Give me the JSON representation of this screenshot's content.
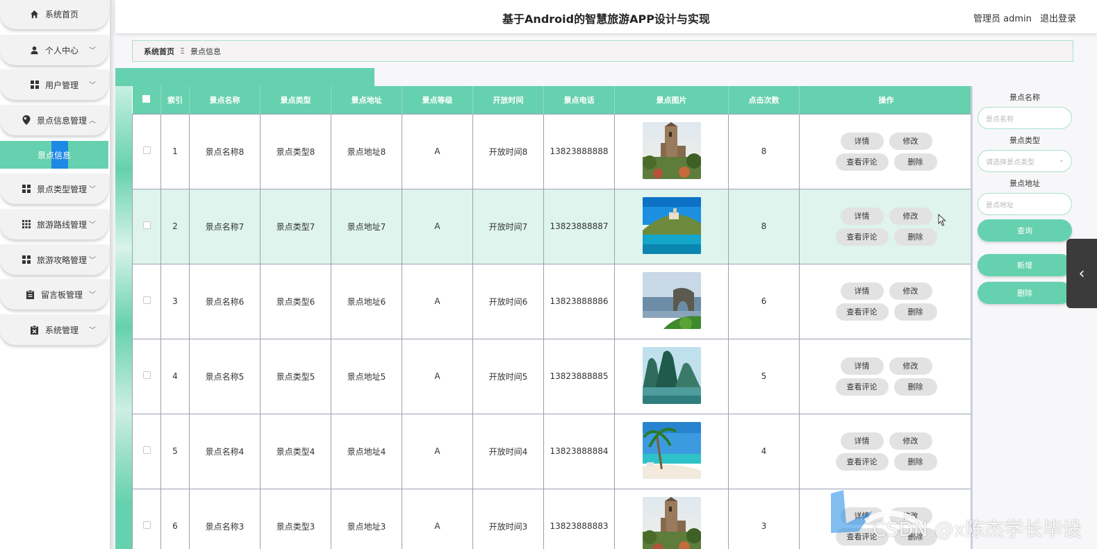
{
  "header": {
    "title": "基于Android的智慧旅游APP设计与实现",
    "user_label": "管理员 admin",
    "logout_label": "退出登录"
  },
  "sidebar": {
    "items": [
      {
        "label": "系统首页",
        "icon": "home-icon",
        "expandable": false
      },
      {
        "label": "个人中心",
        "icon": "user-icon",
        "expandable": true
      },
      {
        "label": "用户管理",
        "icon": "grid-icon",
        "expandable": true
      },
      {
        "label": "景点信息管理",
        "icon": "location-pin-icon",
        "expandable": true,
        "expanded": true
      },
      {
        "label": "景点类型管理",
        "icon": "grid-icon",
        "expandable": true
      },
      {
        "label": "旅游路线管理",
        "icon": "apps-icon",
        "expandable": true
      },
      {
        "label": "旅游攻略管理",
        "icon": "grid-icon",
        "expandable": true
      },
      {
        "label": "留言板管理",
        "icon": "clipboard-icon",
        "expandable": true
      },
      {
        "label": "系统管理",
        "icon": "settings-box-icon",
        "expandable": true
      }
    ],
    "active_sub": "景点信息"
  },
  "breadcrumb": {
    "home": "系统首页",
    "separator": "Ξ",
    "current": "景点信息"
  },
  "table": {
    "headers": [
      "索引",
      "景点名称",
      "景点类型",
      "景点地址",
      "景点等级",
      "开放时间",
      "景点电话",
      "景点图片",
      "点击次数",
      "操作"
    ],
    "rows": [
      {
        "index": "1",
        "name": "景点名称8",
        "type": "景点类型8",
        "address": "景点地址8",
        "level": "A",
        "open_time": "开放时间8",
        "phone": "13823888888",
        "image": "castle-tower-photo",
        "clicks": "8"
      },
      {
        "index": "2",
        "name": "景点名称7",
        "type": "景点类型7",
        "address": "景点地址7",
        "level": "A",
        "open_time": "开放时间7",
        "phone": "13823888887",
        "image": "coastal-town-photo",
        "clicks": "8"
      },
      {
        "index": "3",
        "name": "景点名称6",
        "type": "景点类型6",
        "address": "景点地址6",
        "level": "A",
        "open_time": "开放时间6",
        "phone": "13823888886",
        "image": "sea-arch-photo",
        "clicks": "6"
      },
      {
        "index": "4",
        "name": "景点名称5",
        "type": "景点类型5",
        "address": "景点地址5",
        "level": "A",
        "open_time": "开放时间5",
        "phone": "13823888885",
        "image": "karst-mountains-photo",
        "clicks": "5"
      },
      {
        "index": "5",
        "name": "景点名称4",
        "type": "景点类型4",
        "address": "景点地址4",
        "level": "A",
        "open_time": "开放时间4",
        "phone": "13823888884",
        "image": "palm-beach-photo",
        "clicks": "4"
      },
      {
        "index": "6",
        "name": "景点名称3",
        "type": "景点类型3",
        "address": "景点地址3",
        "level": "A",
        "open_time": "开放时间3",
        "phone": "13823888883",
        "image": "castle-tower-photo",
        "clicks": "3"
      }
    ],
    "hover_row": 1,
    "actions": {
      "detail": "详情",
      "edit": "修改",
      "comments": "查看评论",
      "delete": "删除"
    }
  },
  "search": {
    "name_label": "景点名称",
    "name_placeholder": "景点名称",
    "type_label": "景点类型",
    "type_placeholder": "请选择景点类型",
    "address_label": "景点地址",
    "address_placeholder": "景点地址",
    "query_button": "查询",
    "add_button": "新增",
    "delete_button": "删除"
  },
  "watermark": "CSDN @x陈杰学长毕设",
  "colors": {
    "accent": "#66d1ae",
    "accent_light": "#def4ec",
    "button_gray": "#e2e2e2",
    "highlight_blue": "#1e88e5"
  }
}
